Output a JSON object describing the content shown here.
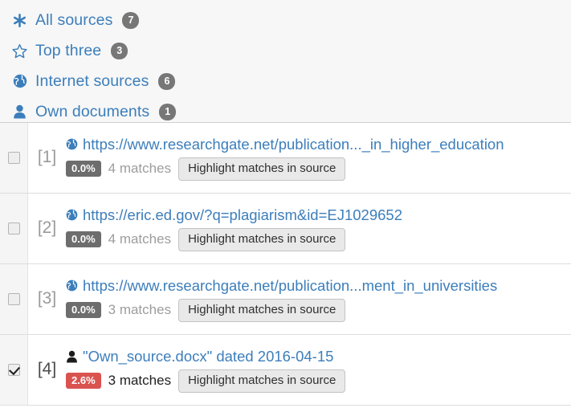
{
  "filters": [
    {
      "icon": "asterisk-icon",
      "label": "All sources",
      "count": "7"
    },
    {
      "icon": "star-outline-icon",
      "label": "Top three",
      "count": "3"
    },
    {
      "icon": "globe-icon",
      "label": "Internet sources",
      "count": "6"
    },
    {
      "icon": "person-icon",
      "label": "Own documents",
      "count": "1"
    }
  ],
  "results": [
    {
      "index": "[1]",
      "checked": false,
      "icon": "globe-icon",
      "source": "https://www.researchgate.net/publication..._in_higher_education",
      "percent": "0.0%",
      "percent_style": "gray",
      "matches": "4 matches",
      "button": "Highlight matches in source"
    },
    {
      "index": "[2]",
      "checked": false,
      "icon": "globe-icon",
      "source": "https://eric.ed.gov/?q=plagiarism&id=EJ1029652",
      "percent": "0.0%",
      "percent_style": "gray",
      "matches": "4 matches",
      "button": "Highlight matches in source"
    },
    {
      "index": "[3]",
      "checked": false,
      "icon": "globe-icon",
      "source": "https://www.researchgate.net/publication...ment_in_universities",
      "percent": "0.0%",
      "percent_style": "gray",
      "matches": "3 matches",
      "button": "Highlight matches in source"
    },
    {
      "index": "[4]",
      "checked": true,
      "icon": "person-icon",
      "source": "\"Own_source.docx\" dated 2016-04-15",
      "percent": "2.6%",
      "percent_style": "danger",
      "matches": "3 matches",
      "button": "Highlight matches in source"
    }
  ],
  "colors": {
    "link_blue": "#3c7ebb",
    "badge_gray": "#777777",
    "percent_gray": "#6d6d6d",
    "percent_danger": "#d9534f",
    "header_bg": "#f7f7f7",
    "checkbox_col_bg": "#f5f5f5"
  }
}
